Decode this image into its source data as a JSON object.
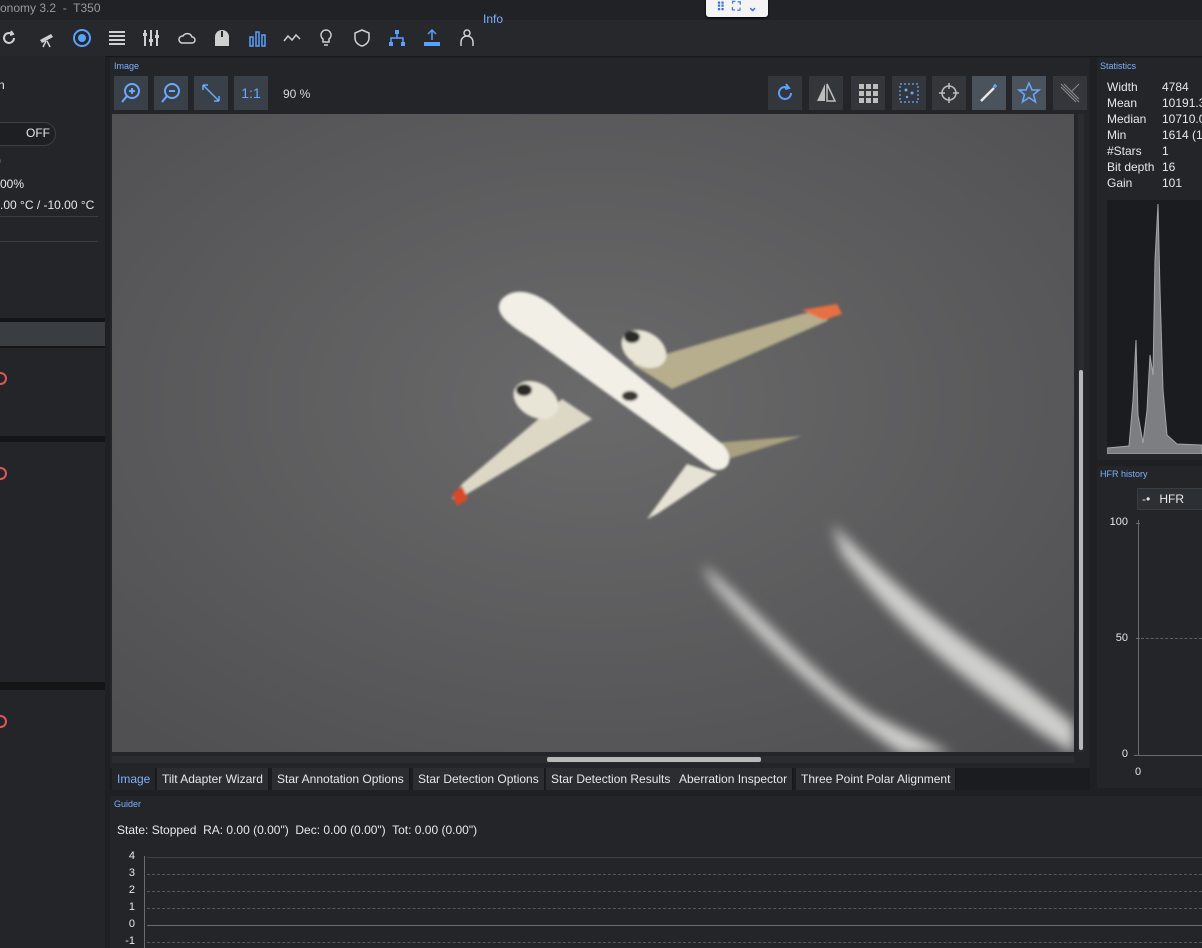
{
  "titlebar": {
    "title": "onomy 3.2  -  T350"
  },
  "toolbar": {
    "icons": [
      "refresh-icon",
      "telescope-icon",
      "target-icon",
      "list-icon",
      "sliders-icon",
      "cloud-icon",
      "house-icon",
      "bar-chart-icon",
      "sequence-icon",
      "bulb-icon",
      "shield-icon",
      "tree-icon",
      "tree-up-icon",
      "person-icon"
    ],
    "info_label": "Info"
  },
  "left_panel": {
    "line1": "n",
    "toggle_label": "OFF",
    "line3": ")",
    "percent": "00%",
    "temps": ".00 °C / -10.00 °C"
  },
  "image_panel": {
    "label": "Image",
    "one_to_one": "1:1",
    "zoom_percent": "90 %"
  },
  "tabs": [
    "Image",
    "Tilt Adapter Wizard",
    "Star Annotation Options",
    "Star Detection Options",
    "Star Detection Results",
    "Aberration Inspector",
    "Three Point Polar Alignment"
  ],
  "statistics": {
    "label": "Statistics",
    "rows": [
      {
        "label": "Width",
        "value": "4784"
      },
      {
        "label": "Mean",
        "value": "10191.3"
      },
      {
        "label": "Median",
        "value": "10710.0"
      },
      {
        "label": "Min",
        "value": "1614 (1"
      },
      {
        "label": "#Stars",
        "value": "1"
      },
      {
        "label": "Bit depth",
        "value": "16"
      },
      {
        "label": "Gain",
        "value": "101"
      }
    ]
  },
  "hfr": {
    "label": "HFR history",
    "legend": "HFR",
    "y_ticks": [
      "100",
      "50",
      "0"
    ],
    "x_tick": "0"
  },
  "guider": {
    "label": "Guider",
    "state": "State: Stopped  RA: 0.00 (0.00\")  Dec: 0.00 (0.00\")  Tot: 0.00 (0.00\")",
    "y_ticks": [
      "4",
      "3",
      "2",
      "1",
      "0",
      "-1"
    ]
  }
}
